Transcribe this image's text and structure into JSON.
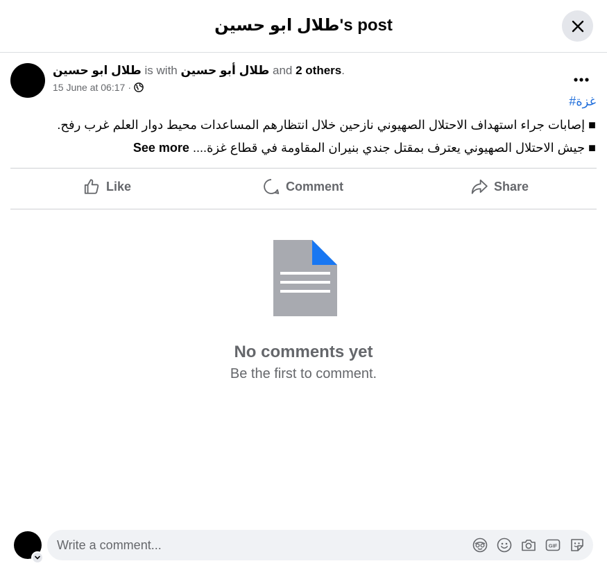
{
  "header": {
    "title": "طلال ابو حسين's post"
  },
  "post": {
    "author": "طلال ابو حسين",
    "with_text": "is with",
    "tagged": "طلال أبو حسين",
    "and_text": "and",
    "others": "2 others",
    "period": ".",
    "timestamp": "15 June at 06:17",
    "separator": "·",
    "privacy_icon": "globe-icon",
    "hashtag": "#غزة",
    "lines": [
      "■ إصابات جراء استهداف الاحتلال الصهيوني نازحين خلال انتظارهم المساعدات محيط دوار العلم غرب رفح.",
      "■ جيش الاحتلال الصهيوني يعترف بمقتل جندي بنيران المقاومة في قطاع غزة...."
    ],
    "see_more": "See more"
  },
  "actions": {
    "like": "Like",
    "comment": "Comment",
    "share": "Share"
  },
  "empty_state": {
    "title": "No comments yet",
    "subtitle": "Be the first to comment."
  },
  "composer": {
    "placeholder": "Write a comment...",
    "icons": [
      "avatar-sticker-icon",
      "emoji-icon",
      "camera-icon",
      "gif-icon",
      "sticker-icon"
    ]
  },
  "colors": {
    "accent": "#216fdb",
    "muted_text": "#65676b",
    "illustration_gray": "#a8aab0",
    "illustration_corner": "#1877f2"
  }
}
